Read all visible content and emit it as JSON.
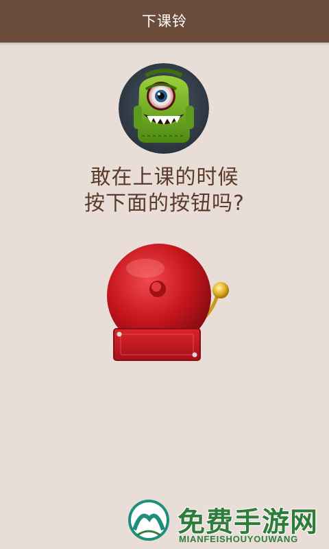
{
  "header": {
    "title": "下课铃"
  },
  "avatar": {
    "icon": "one-eyed-monster-icon",
    "accent": "#7cb82a"
  },
  "prompt": {
    "line1": "敢在上课的时候",
    "line2": "按下面的按钮吗?"
  },
  "bell_button": {
    "icon": "school-bell-icon",
    "color": "#c8161d"
  },
  "watermark": {
    "title": "免费手游网",
    "subtitle": "MIANFEISHOUYOUWANG",
    "icon": "mianfei-logo-icon"
  },
  "colors": {
    "header_bg": "#6b4c3b",
    "page_bg": "#e8ddd7",
    "text": "#5a3a2a"
  }
}
